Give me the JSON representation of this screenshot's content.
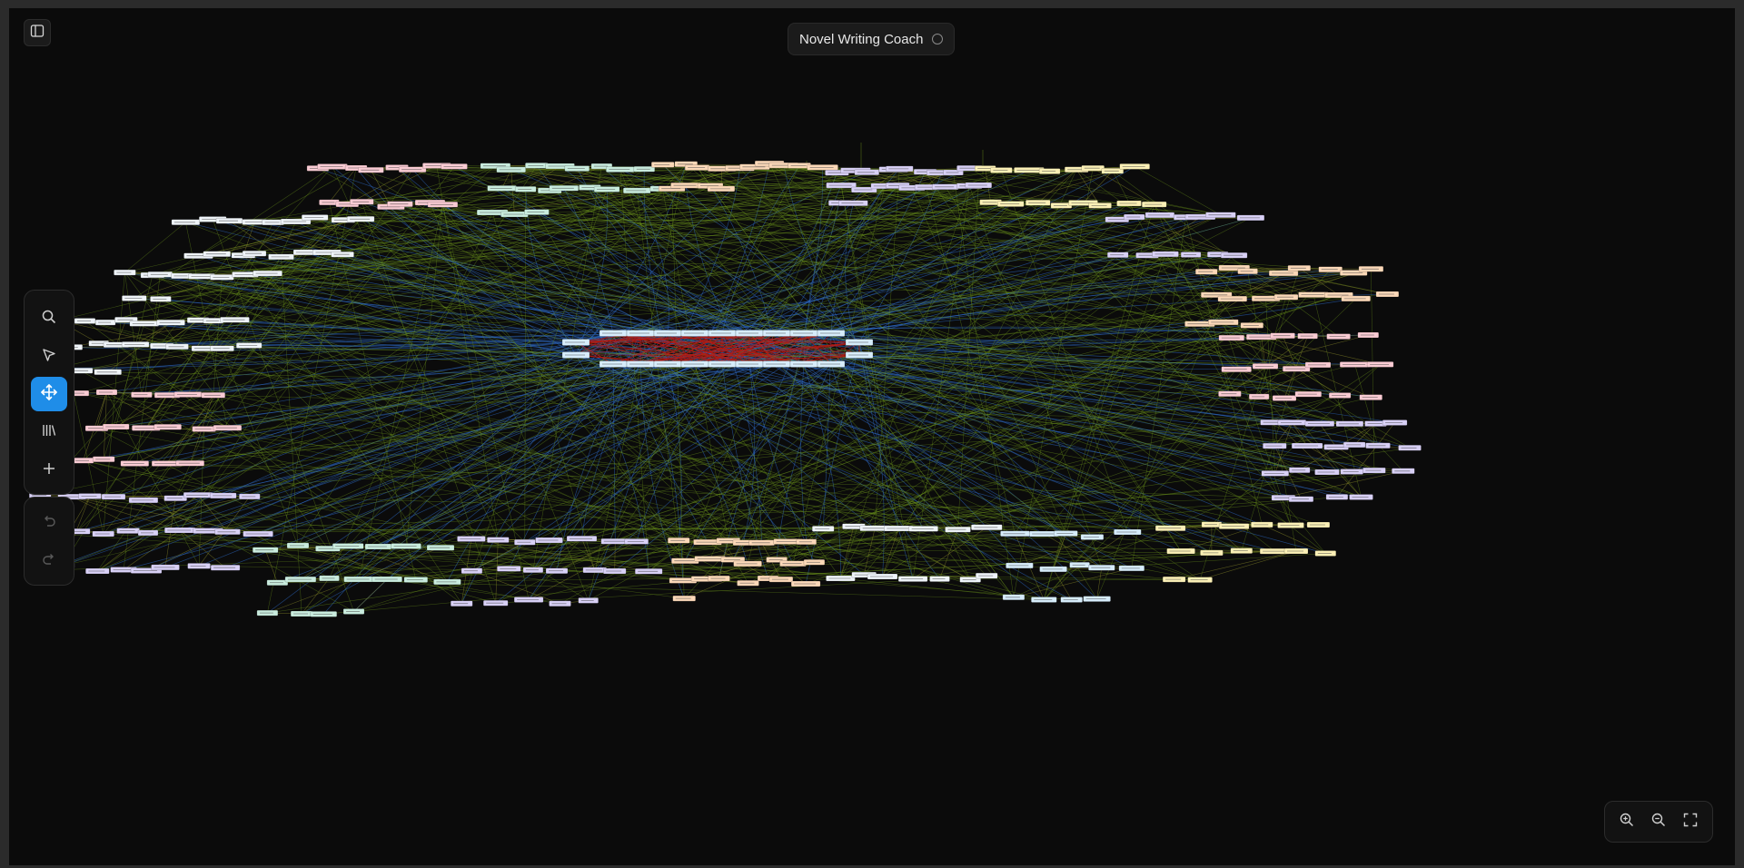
{
  "app": {
    "title": "Novel Writing Coach"
  },
  "icons": {
    "sidebar_toggle": "sidebar-toggle-icon",
    "status": "status-circle-icon",
    "tools": [
      "search-icon",
      "pointer-icon",
      "move-icon",
      "library-icon",
      "plus-icon"
    ],
    "history": [
      "undo-icon",
      "redo-icon"
    ],
    "zoom": [
      "zoom-in-icon",
      "zoom-out-icon",
      "fullscreen-icon"
    ]
  },
  "toolbar": {
    "active_tool": "move"
  },
  "colors": {
    "canvas_background": "#0b0b0b",
    "accent": "#1f8de8",
    "edge_core": "#b81a12",
    "edge_green": "#6f9a1c",
    "edge_blue": "#2f6fd0",
    "node_pink": "#f9cbd3",
    "node_mint": "#c9ecde",
    "node_peach": "#fbd8b8",
    "node_lavender": "#d8d0f6",
    "node_yellow": "#fbf0b6",
    "node_white": "#eef3f8",
    "node_skyblue": "#d6ecfa"
  },
  "graph": {
    "core_cluster_id": "core",
    "clusters": [
      {
        "id": "core",
        "color": "#d6ecfa",
        "node_count": 22
      },
      {
        "id": "top-pink",
        "color": "#f9cbd3",
        "node_count": 15
      },
      {
        "id": "top-mint",
        "color": "#c9ecde",
        "node_count": 19
      },
      {
        "id": "top-peach",
        "color": "#fbd8b8",
        "node_count": 14
      },
      {
        "id": "top-lavender",
        "color": "#d8d0f6",
        "node_count": 20
      },
      {
        "id": "top-yellow",
        "color": "#fbf0b6",
        "node_count": 16
      },
      {
        "id": "left-white-1",
        "color": "#eef3f8",
        "node_count": 17
      },
      {
        "id": "left-white-2",
        "color": "#eef3f8",
        "node_count": 10
      },
      {
        "id": "left-white-3",
        "color": "#eef3f8",
        "node_count": 21
      },
      {
        "id": "left-pink",
        "color": "#f9cbd3",
        "node_count": 17
      },
      {
        "id": "bottom-left-lavender",
        "color": "#d8d0f6",
        "node_count": 26
      },
      {
        "id": "bottom-mint",
        "color": "#c9ecde",
        "node_count": 18
      },
      {
        "id": "bottom-lavender",
        "color": "#d8d0f6",
        "node_count": 19
      },
      {
        "id": "bottom-peach",
        "color": "#fbd8b8",
        "node_count": 22
      },
      {
        "id": "bottom-white",
        "color": "#eef3f8",
        "node_count": 14
      },
      {
        "id": "bottom-skyblue",
        "color": "#d6ecfa",
        "node_count": 14
      },
      {
        "id": "bottom-yellow",
        "color": "#fbf0b6",
        "node_count": 14
      },
      {
        "id": "right-lavender-1",
        "color": "#d8d0f6",
        "node_count": 13
      },
      {
        "id": "right-peach",
        "color": "#fbd8b8",
        "node_count": 19
      },
      {
        "id": "right-pink",
        "color": "#f9cbd3",
        "node_count": 18
      },
      {
        "id": "right-lavender-2",
        "color": "#d8d0f6",
        "node_count": 22
      }
    ]
  }
}
